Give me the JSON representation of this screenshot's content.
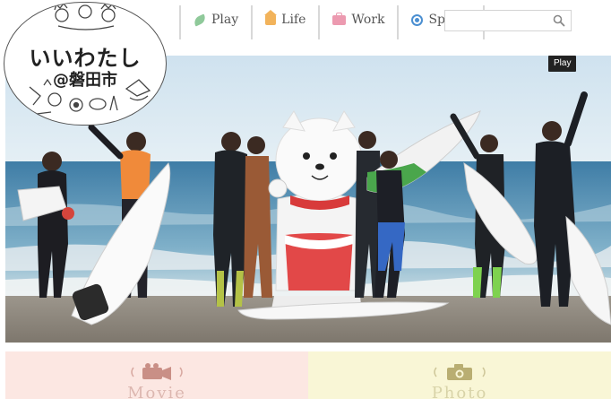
{
  "site": {
    "logo_title": "いいわたし",
    "logo_subtitle": "@磐田市"
  },
  "nav": {
    "items": [
      {
        "label": "Play",
        "icon": "leaf-icon",
        "color": "#8fc99a"
      },
      {
        "label": "Life",
        "icon": "house-icon",
        "color": "#f2b35b"
      },
      {
        "label": "Work",
        "icon": "briefcase-icon",
        "color": "#ec9ab0"
      },
      {
        "label": "Sports",
        "icon": "ball-icon",
        "color": "#4b8fd1"
      }
    ]
  },
  "search": {
    "value": "",
    "placeholder": ""
  },
  "hero": {
    "tooltip": "Play"
  },
  "cards": [
    {
      "label": "Movie",
      "icon": "video-camera-icon",
      "bg": "#fce7e2"
    },
    {
      "label": "Photo",
      "icon": "photo-camera-icon",
      "bg": "#f9f6d6"
    }
  ]
}
